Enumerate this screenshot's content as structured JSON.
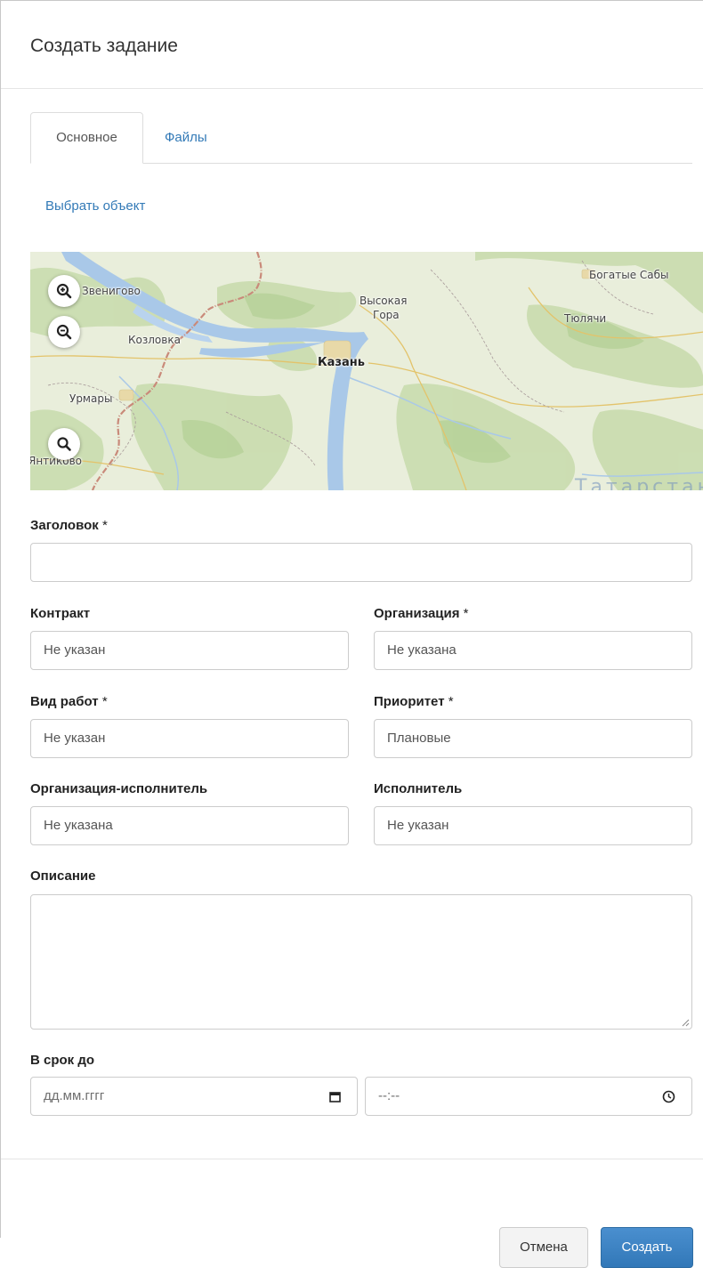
{
  "dialog": {
    "title": "Создать задание"
  },
  "tabs": [
    {
      "label": "Основное",
      "active": true
    },
    {
      "label": "Файлы",
      "active": false
    }
  ],
  "select_object_link": "Выбрать объект",
  "map": {
    "labels": {
      "zvenigovo": "Звенигово",
      "kozlovka": "Козловка",
      "urmary": "Урмары",
      "yantikovo": "Янтиково",
      "vysokaya": "Высокая",
      "gora": "Гора",
      "kazan": "Казань",
      "bogatye_saby": "Богатые Сабы",
      "tyulyachi": "Тюлячи",
      "tatarstan": "Татарстан"
    },
    "controls": [
      "zoom-in-icon",
      "zoom-out-icon",
      "search-icon"
    ]
  },
  "form": {
    "title_label": "Заголовок",
    "title_value": "",
    "contract_label": "Контракт",
    "contract_value": "Не указан",
    "organization_label": "Организация",
    "organization_value": "Не указана",
    "work_type_label": "Вид работ",
    "work_type_value": "Не указан",
    "priority_label": "Приоритет",
    "priority_value": "Плановые",
    "contractor_org_label": "Организация-исполнитель",
    "contractor_org_value": "Не указана",
    "executor_label": "Исполнитель",
    "executor_value": "Не указан",
    "description_label": "Описание",
    "description_value": "",
    "deadline_label": "В срок до",
    "date_placeholder": "дд.мм.гггг",
    "time_placeholder": "--:--",
    "required_mark": "*"
  },
  "footer": {
    "cancel_label": "Отмена",
    "create_label": "Создать"
  },
  "colors": {
    "link": "#337ab7",
    "primary": "#3a7fc1",
    "river": "#a9c8e8",
    "border_region": "#c98a7a"
  }
}
